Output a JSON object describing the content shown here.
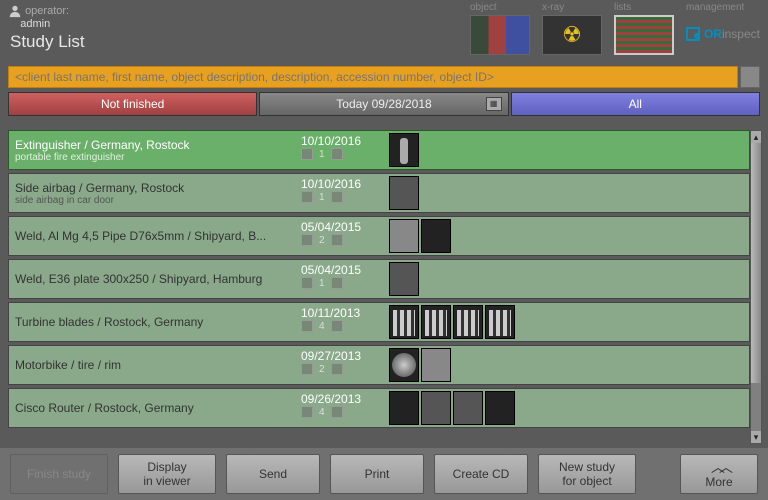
{
  "header": {
    "operator_label": "operator:",
    "operator_value": "admin",
    "page_title": "Study List"
  },
  "nav": {
    "object": "object",
    "xray": "x-ray",
    "lists": "lists",
    "management": "management",
    "brand_strong": "OR",
    "brand_light": "inspect"
  },
  "search": {
    "placeholder": "<client last name, first name, object description, description, accession number, object ID>"
  },
  "filters": {
    "not_finished": "Not finished",
    "today": "Today 09/28/2018",
    "all": "All"
  },
  "studies": [
    {
      "title": "Extinguisher / Germany, Rostock",
      "sub": "portable fire extinguisher",
      "date": "10/10/2016",
      "count": "1",
      "thumbs": [
        "bottle"
      ],
      "selected": true
    },
    {
      "title": "Side airbag / Germany, Rostock",
      "sub": "side airbag in car door",
      "date": "10/10/2016",
      "count": "1",
      "thumbs": [
        "mid"
      ],
      "selected": false
    },
    {
      "title": "Weld, Al Mg 4,5 Pipe D76x5mm / Shipyard, B...",
      "sub": "",
      "date": "05/04/2015",
      "count": "2",
      "thumbs": [
        "light",
        "dark"
      ],
      "selected": false
    },
    {
      "title": "Weld, E36 plate 300x250 / Shipyard, Hamburg",
      "sub": "",
      "date": "05/04/2015",
      "count": "1",
      "thumbs": [
        "mid"
      ],
      "selected": false
    },
    {
      "title": "Turbine blades / Rostock, Germany",
      "sub": "",
      "date": "10/11/2013",
      "count": "4",
      "thumbs": [
        "bars",
        "bars",
        "bars",
        "bars"
      ],
      "selected": false
    },
    {
      "title": "Motorbike / tire / rim",
      "sub": "",
      "date": "09/27/2013",
      "count": "2",
      "thumbs": [
        "round",
        "light"
      ],
      "selected": false
    },
    {
      "title": "Cisco Router / Rostock, Germany",
      "sub": "",
      "date": "09/26/2013",
      "count": "4",
      "thumbs": [
        "dark",
        "mid",
        "mid",
        "dark"
      ],
      "selected": false
    }
  ],
  "toolbar": {
    "finish": "Finish study",
    "display": "Display\nin viewer",
    "send": "Send",
    "print": "Print",
    "create_cd": "Create CD",
    "new_study": "New study\nfor object",
    "more": "More"
  }
}
